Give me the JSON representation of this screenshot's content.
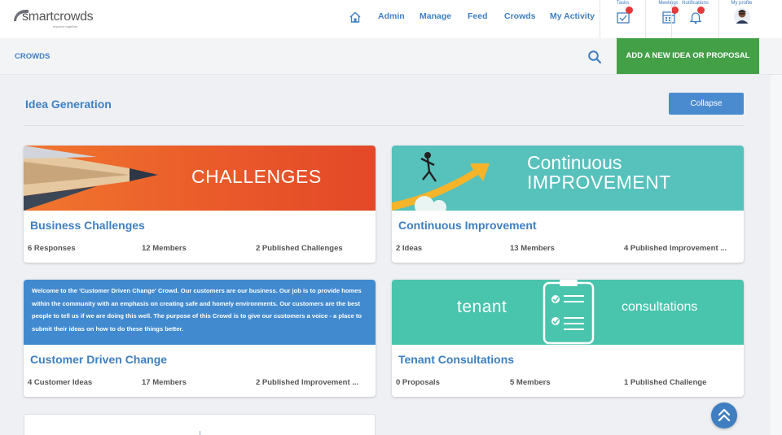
{
  "brand": {
    "name": "smartcrowds",
    "tagline": "Improve together"
  },
  "nav": {
    "links": [
      "Admin",
      "Manage",
      "Feed",
      "Crowds",
      "My Activity"
    ],
    "icons": [
      {
        "label": "Tasks",
        "icon": "tasks-icon"
      },
      {
        "label": "Meetings",
        "icon": "calendar-icon"
      },
      {
        "label": "Notifications",
        "icon": "bell-icon"
      },
      {
        "label": "My profile",
        "icon": "avatar"
      }
    ]
  },
  "subheader": {
    "crumb": "CROWDS",
    "add_button": "ADD A NEW IDEA OR PROPOSAL"
  },
  "section": {
    "title": "Idea Generation",
    "collapse": "Collapse"
  },
  "colors": {
    "accent": "#3f7fc1",
    "green": "#43a047",
    "badge": "#e5393a"
  },
  "cards": [
    {
      "title": "Business Challenges",
      "banner": {
        "text": "CHALLENGES"
      },
      "stats": [
        "6 Responses",
        "12 Members",
        "2 Published Challenges"
      ]
    },
    {
      "title": "Continuous Improvement",
      "banner": {
        "line1": "Continuous",
        "line2": "IMPROVEMENT"
      },
      "stats": [
        "2 Ideas",
        "13 Members",
        "4 Published Improvement ..."
      ]
    },
    {
      "title": "Customer Driven Change",
      "banner": {
        "text": "Welcome to the 'Customer Driven Change' Crowd. Our customers are our business. Our job is to provide homes within the community with an emphasis on creating safe and homely environments. Our customers are the best people to tell us if we are doing this well. The purpose of this Crowd is to give our customers a voice - a place to submit their ideas on how to do these things better."
      },
      "stats": [
        "4 Customer Ideas",
        "17 Members",
        "2 Published Improvement ..."
      ]
    },
    {
      "title": "Tenant Consultations",
      "banner": {
        "left": "tenant",
        "right": "consultations"
      },
      "stats": [
        "0 Proposals",
        "5 Members",
        "1 Published Challenge"
      ]
    }
  ]
}
